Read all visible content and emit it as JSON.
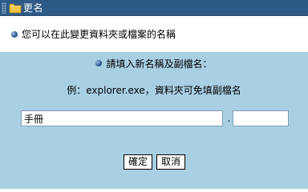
{
  "dialog": {
    "title": "更名",
    "title_icon": "folder-icon",
    "info_text": "您可以在此變更資料夾或檔案的名稱"
  },
  "form": {
    "prompt": "請填入新名稱及副檔名：",
    "example": "例：explorer.exe，資料夾可免填副檔名",
    "name_value": "手冊",
    "separator": ".",
    "extension_value": ""
  },
  "buttons": {
    "ok_label": "確定",
    "cancel_label": "取消"
  },
  "colors": {
    "titlebar": "#2e5a88",
    "panel": "#a9cfe3",
    "bullet": "#3c6aa6"
  }
}
